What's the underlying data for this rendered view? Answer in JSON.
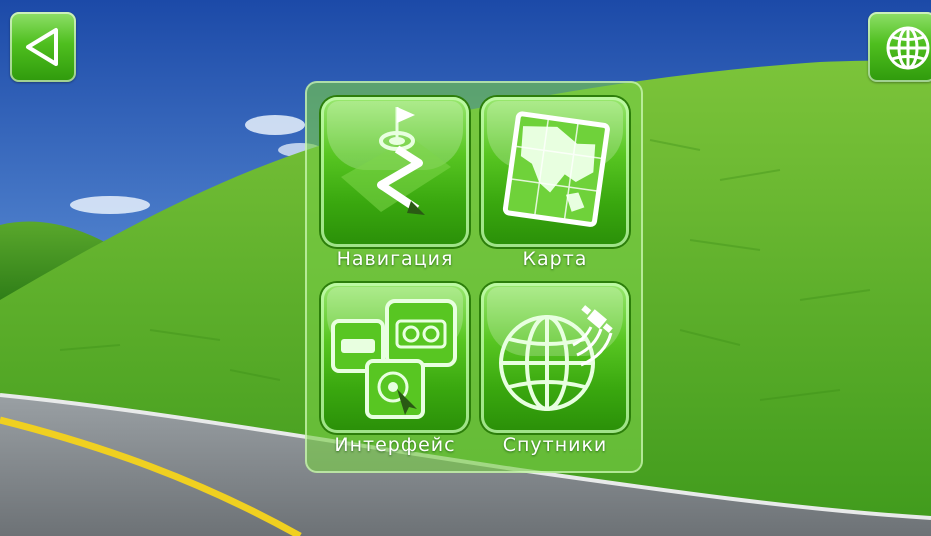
{
  "top_bar": {
    "back_icon": "back-triangle-icon",
    "globe_icon": "globe-icon"
  },
  "menu": {
    "items": [
      {
        "label": "Навигация",
        "icon": "navigation-route-icon"
      },
      {
        "label": "Карта",
        "icon": "map-icon"
      },
      {
        "label": "Интерфейс",
        "icon": "interface-settings-icon"
      },
      {
        "label": "Спутники",
        "icon": "satellite-globe-icon"
      }
    ]
  },
  "colors": {
    "accent_green": "#4fbf1f",
    "sky_blue": "#2a5db0",
    "road_line_yellow": "#f0d020"
  }
}
